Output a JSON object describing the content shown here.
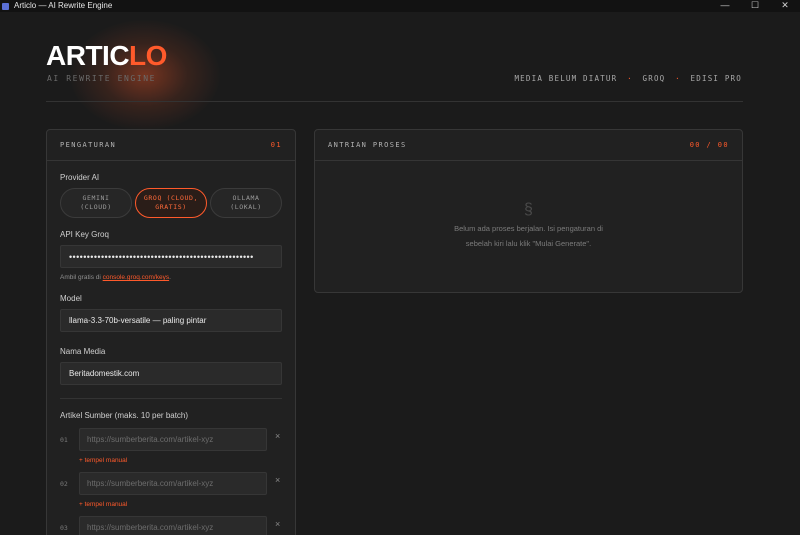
{
  "window": {
    "title": "Articlo — AI Rewrite Engine",
    "controls": {
      "minimize": "—",
      "maximize": "☐",
      "close": "✕"
    }
  },
  "brand": {
    "logo_part1": "ARTIC",
    "logo_part2": "LO",
    "tagline": "AI REWRITE ENGINE",
    "accent": "#ff5a2b"
  },
  "status": {
    "media": "MEDIA BELUM DIATUR",
    "provider": "GROQ",
    "edition": "EDISI PRO",
    "separator": "·"
  },
  "settings": {
    "title": "PENGATURAN",
    "number": "01",
    "provider_label": "Provider AI",
    "providers": [
      {
        "label": "GEMINI\n(CLOUD)",
        "active": false
      },
      {
        "label": "GROQ (CLOUD,\nGRATIS)",
        "active": true
      },
      {
        "label": "OLLAMA\n(LOKAL)",
        "active": false
      }
    ],
    "api_key_label": "API Key Groq",
    "api_key_value": "••••••••••••••••••••••••••••••••••••••••••••••••••••",
    "hint_prefix": "Ambil gratis di ",
    "hint_link": "console.groq.com/keys",
    "hint_suffix": ".",
    "model_label": "Model",
    "model_value": "llama-3.3-70b-versatile — paling pintar",
    "media_label": "Nama Media",
    "media_value": "Beritadomestik.com",
    "sources_label": "Artikel Sumber (maks. 10 per batch)",
    "sources": [
      {
        "num": "01",
        "placeholder": "https://sumberberita.com/artikel-xyz",
        "manual": "+ tempel manual"
      },
      {
        "num": "02",
        "placeholder": "https://sumberberita.com/artikel-xyz",
        "manual": "+ tempel manual"
      },
      {
        "num": "03",
        "placeholder": "https://sumberberita.com/artikel-xyz",
        "manual": ""
      }
    ],
    "remove_glyph": "×"
  },
  "queue": {
    "title": "ANTRIAN PROSES",
    "count": "00 / 00",
    "empty_icon": "§",
    "empty_line1": "Belum ada proses berjalan. Isi pengaturan di",
    "empty_line2": "sebelah kiri lalu klik \"Mulai Generate\"."
  }
}
